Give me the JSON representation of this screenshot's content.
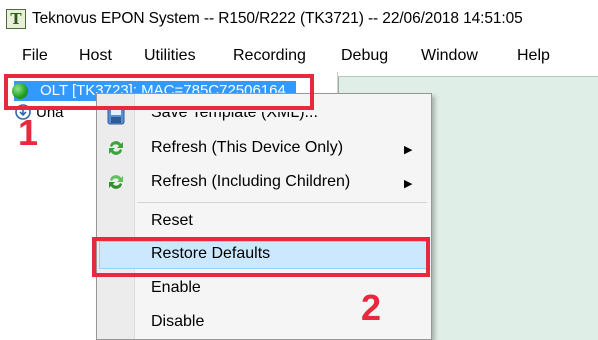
{
  "window": {
    "app_icon_glyph": "T",
    "title": "Teknovus EPON System -- R150/R222 (TK3721) -- 22/06/2018 14:51:05"
  },
  "menubar": {
    "items": [
      "File",
      "Host",
      "Utilities",
      "Recording",
      "Debug",
      "Window",
      "Help"
    ]
  },
  "tree": {
    "selected_node": "OLT [TK3723]: MAC=785C72506164",
    "second_node": "Una"
  },
  "context_menu": {
    "items": [
      {
        "label": "Save Template (XML)...",
        "icon": "save-icon",
        "submenu": false
      },
      {
        "label": "Refresh (This Device Only)",
        "icon": "refresh-icon",
        "submenu": true
      },
      {
        "label": "Refresh (Including Children)",
        "icon": "refresh-children-icon",
        "submenu": true
      },
      {
        "label": "Reset",
        "icon": "",
        "submenu": false
      },
      {
        "label": "Restore Defaults",
        "icon": "",
        "submenu": false,
        "highlighted": true
      },
      {
        "label": "Enable",
        "icon": "",
        "submenu": false
      },
      {
        "label": "Disable",
        "icon": "",
        "submenu": false
      }
    ]
  },
  "annotations": {
    "step1": "1",
    "step2": "2",
    "color": "#e8283c"
  },
  "colors": {
    "selection": "#3399ff",
    "menu_highlight": "#cce8ff",
    "right_pane": "#dfeee6"
  }
}
